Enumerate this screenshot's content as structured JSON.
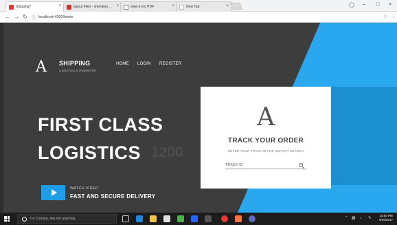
{
  "browser": {
    "tabs": [
      {
        "title": "Shipping7",
        "favicon_color": "#e53935",
        "active": true
      },
      {
        "title": "layout Files - shenders...",
        "favicon_color": "#d93025",
        "active": false
      },
      {
        "title": "view-2.vro PDF",
        "favicon_color": "#888888",
        "active": false
      },
      {
        "title": "New Tab",
        "favicon_color": "#bbbbbb",
        "active": false
      }
    ],
    "url": "localhost:4300/home",
    "close_glyph": "×"
  },
  "site": {
    "logo_letter": "A",
    "brand_name": "SHIPPING",
    "brand_tagline": "LOGISTICS & TRANSPORT",
    "nav": [
      "HOME",
      "LOGIN",
      "REGISTER"
    ],
    "hero_line1": "FIRST CLASS",
    "hero_line2": "LOGISTICS",
    "hero_ghost_number": "1200",
    "watch_label": "WATCH VIDEO",
    "watch_headline": "FAST AND SECURE DELIVERY",
    "colors": {
      "dark": "#3d3d3d",
      "accent_blue": "#29a8f0",
      "deep_blue": "#1b8fd0"
    }
  },
  "track_card": {
    "logo_letter": "A",
    "title": "TRACK YOUR ORDER",
    "subtitle": "ENTER YOUR TRACK ID FOR INSTANT SEARCH",
    "input_placeholder": "TRACK ID"
  },
  "taskbar": {
    "cortana_text": "I'm Cortana. Ask me anything.",
    "time": "10:50 PM",
    "date": "9/25/2017"
  }
}
